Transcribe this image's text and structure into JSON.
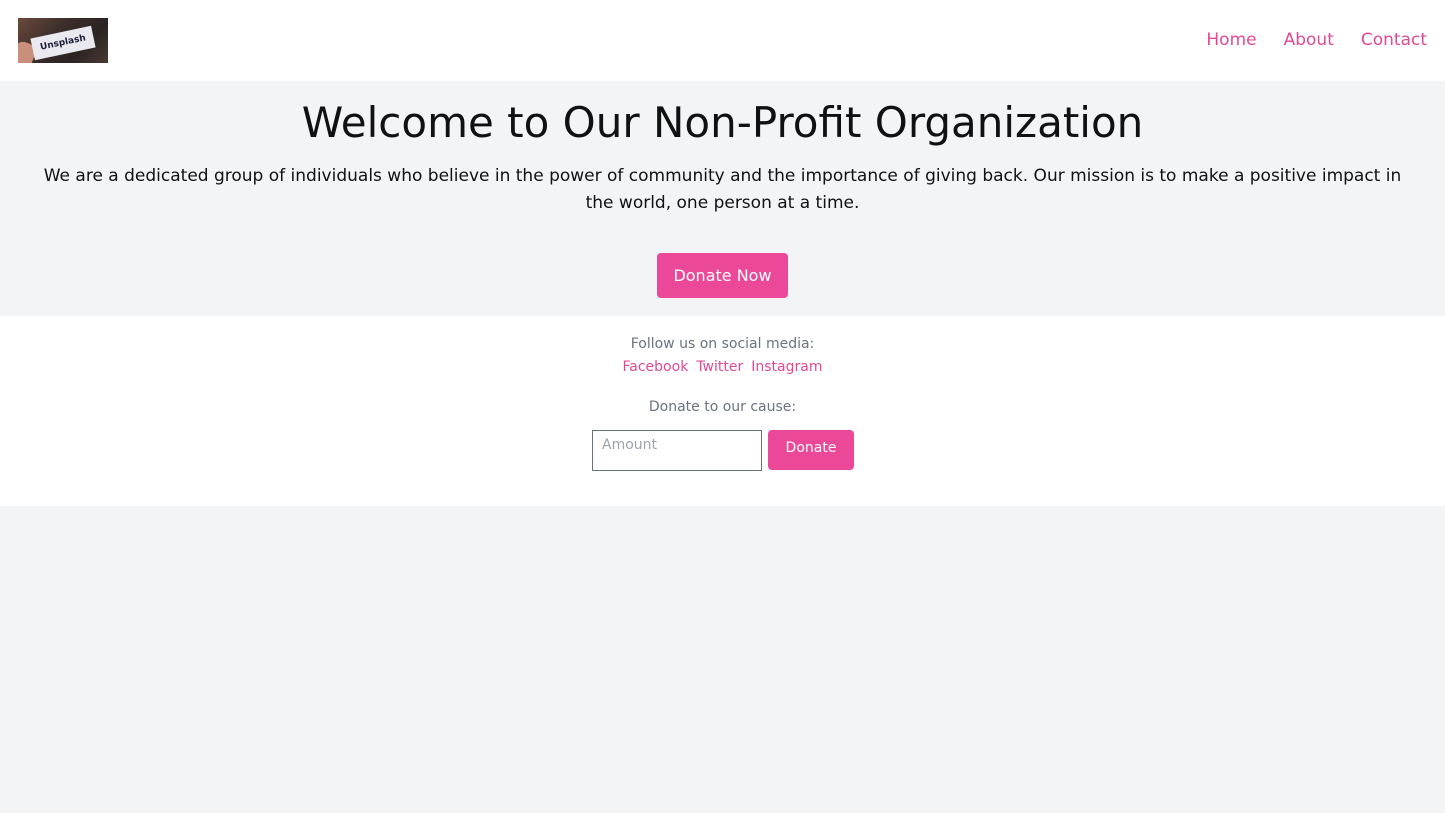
{
  "header": {
    "logo_text": "Unsplash",
    "nav": [
      "Home",
      "About",
      "Contact"
    ]
  },
  "hero": {
    "title": "Welcome to Our Non-Profit Organization",
    "description": "We are a dedicated group of individuals who believe in the power of community and the importance of giving back. Our mission is to make a positive impact in the world, one person at a time.",
    "cta_label": "Donate Now"
  },
  "footer": {
    "follow_text": "Follow us on social media:",
    "social_links": [
      "Facebook",
      "Twitter",
      "Instagram"
    ],
    "donate_text": "Donate to our cause:",
    "amount_placeholder": "Amount",
    "donate_button": "Donate"
  },
  "colors": {
    "accent": "#ec4899",
    "link": "#e04a95",
    "page_background": "#f3f4f6",
    "muted_text": "#6b7280"
  }
}
